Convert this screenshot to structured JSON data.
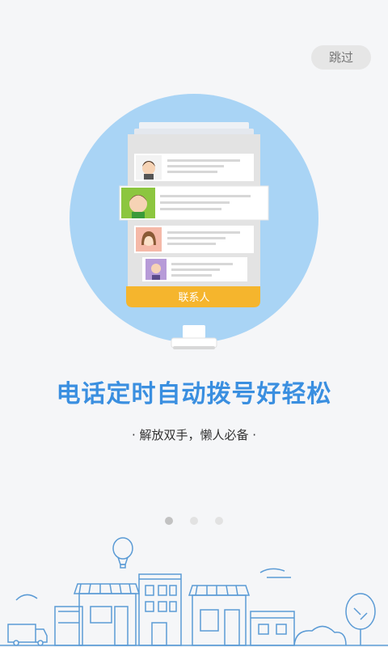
{
  "header": {
    "skip_label": "跳过"
  },
  "illustration": {
    "contacts_button_label": "联系人"
  },
  "content": {
    "headline": "电话定时自动拨号好轻松",
    "subline": "· 解放双手，懒人必备 ·"
  },
  "pagination": {
    "current": 1,
    "total": 3
  },
  "colors": {
    "accent": "#3a8fe0",
    "circle": "#a9d4f5",
    "contact_bar": "#f5b52d",
    "skyline": "#5b9bd5"
  }
}
